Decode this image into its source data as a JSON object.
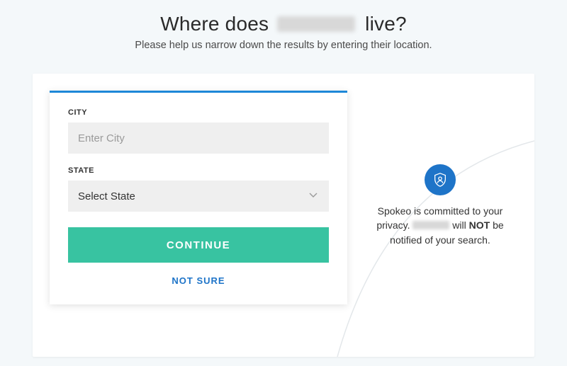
{
  "header": {
    "title_prefix": "Where does",
    "title_suffix": "live?",
    "subtitle": "Please help us narrow down the results by entering their location."
  },
  "form": {
    "city_label": "CITY",
    "city_placeholder": "Enter City",
    "city_value": "",
    "state_label": "STATE",
    "state_selected": "Select State",
    "continue_label": "CONTINUE",
    "not_sure_label": "NOT SURE"
  },
  "privacy": {
    "text_1": "Spokeo is committed to your privacy.",
    "text_2": "will",
    "text_bold": "NOT",
    "text_3": "be notified of your search."
  },
  "colors": {
    "accent_blue": "#1e74c8",
    "top_border": "#1e88d8",
    "continue_green": "#38c3a1"
  }
}
